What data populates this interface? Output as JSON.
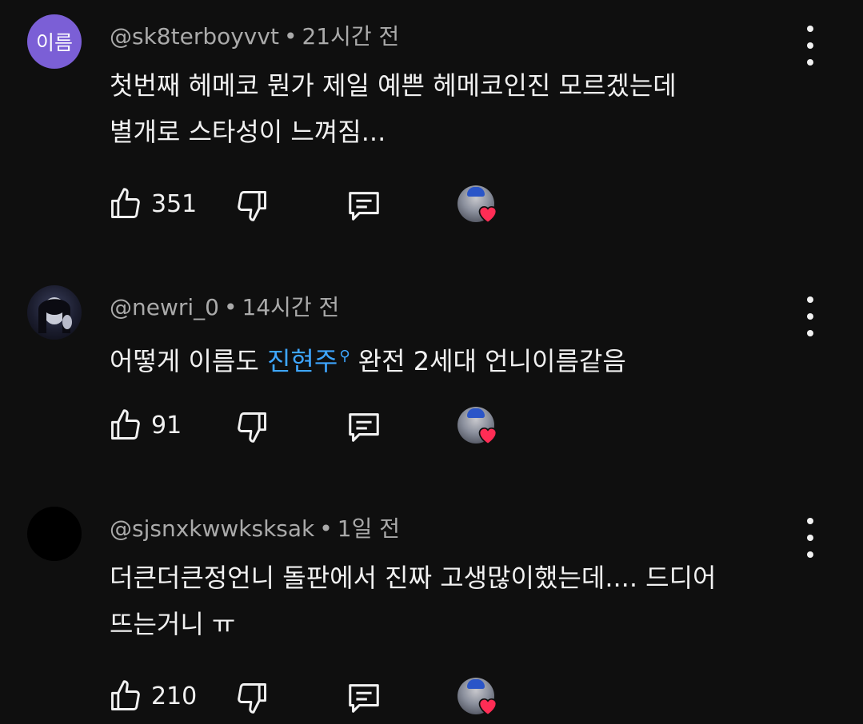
{
  "comments": [
    {
      "avatar_type": "text",
      "avatar_text": "이름",
      "avatar_color": "#7b5fd6",
      "author": "@sk8terboyvvt",
      "time": "21시간 전",
      "lines": [
        "첫번째 헤메코 뭔가 제일 예쁜 헤메코인진 모르겠는데",
        "별개로 스타성이 느껴짐..."
      ],
      "likes": "351"
    },
    {
      "avatar_type": "photo",
      "author": "@newri_0",
      "time": "14시간 전",
      "text_before": "어떻게 이름도 ",
      "link_text": "진현주",
      "link_icon": "search-icon",
      "text_after": " 완전 2세대 언니이름같음",
      "likes": "91"
    },
    {
      "avatar_type": "black",
      "author": "@sjsnxkwwksksak",
      "time": "1일 전",
      "lines": [
        "더큰더큰정언니 돌판에서 진짜 고생많이했는데.... 드디어",
        "뜨는거니 ㅠ"
      ],
      "likes": "210"
    }
  ],
  "colors": {
    "background": "#0f0f0f",
    "meta_text": "#aaaaaa",
    "link": "#3ea6ff",
    "heart": "#ff2d55"
  },
  "icons": [
    "thumbs-up-icon",
    "thumbs-down-icon",
    "reply-icon",
    "more-vert-icon",
    "creator-heart-icon"
  ]
}
